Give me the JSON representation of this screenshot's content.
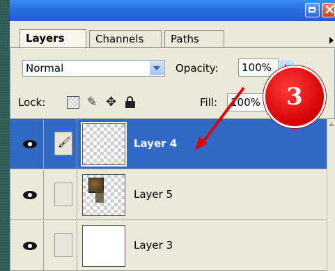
{
  "tabs": [
    {
      "label": "Layers",
      "active": true
    },
    {
      "label": "Channels",
      "active": false
    },
    {
      "label": "Paths",
      "active": false
    }
  ],
  "blend_mode": {
    "value": "Normal"
  },
  "opacity": {
    "label": "Opacity:",
    "value": "100%"
  },
  "lock": {
    "label": "Lock:"
  },
  "fill": {
    "label": "Fill:",
    "value": "100%"
  },
  "layers": [
    {
      "name": "Layer 4",
      "selected": true,
      "visible": true,
      "brush": true,
      "thumb": "transparent"
    },
    {
      "name": "Layer 5",
      "selected": false,
      "visible": true,
      "brush": false,
      "thumb": "image"
    },
    {
      "name": "Layer 3",
      "selected": false,
      "visible": true,
      "brush": false,
      "thumb": "white"
    }
  ],
  "annotation": {
    "number": "3",
    "color": "#e00000"
  },
  "colors": {
    "selection": "#316ac5",
    "titlebar": "#2a6fe0",
    "panel": "#ece9d8"
  }
}
